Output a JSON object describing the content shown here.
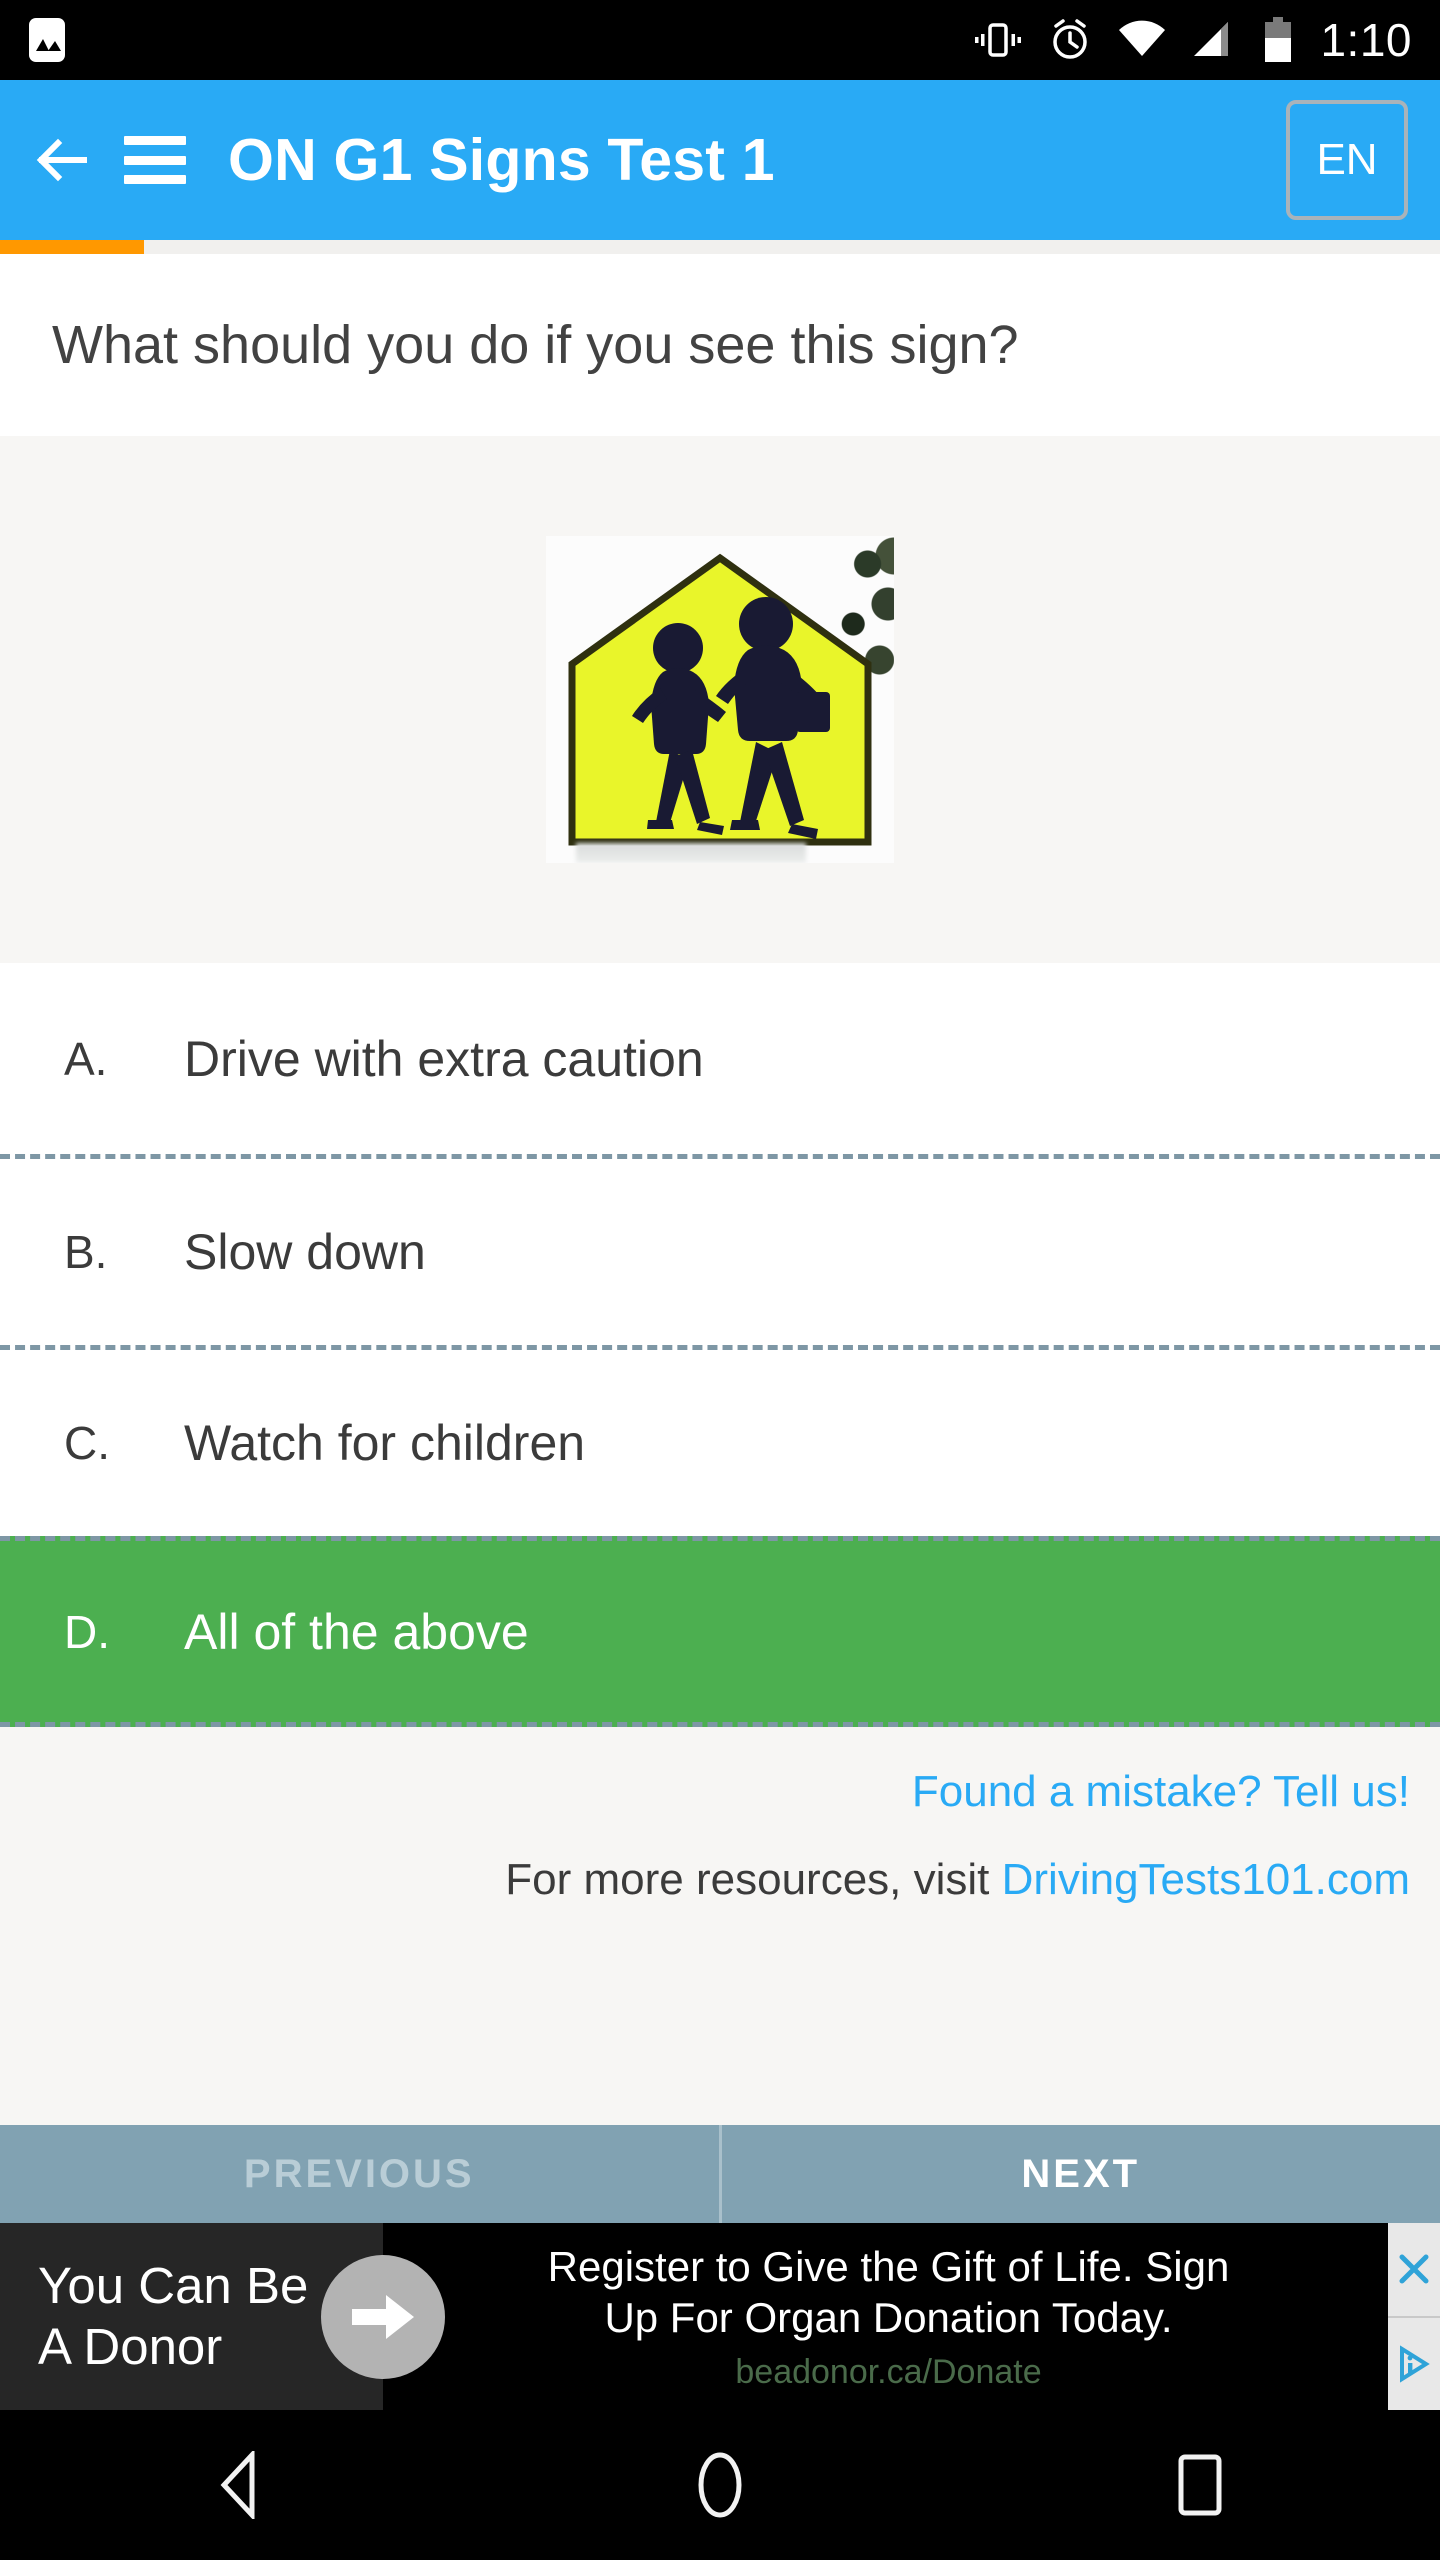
{
  "status_bar": {
    "time": "1:10",
    "icons": [
      "photo-icon",
      "vibrate-icon",
      "alarm-icon",
      "wifi-icon",
      "signal-icon",
      "battery-icon"
    ]
  },
  "app_bar": {
    "title": "ON G1 Signs Test 1",
    "back_icon": "back-arrow-icon",
    "menu_icon": "hamburger-menu-icon",
    "language_label": "EN"
  },
  "progress": {
    "percent": 10,
    "color": "#ff9800"
  },
  "question": {
    "text": "What should you do if you see this sign?",
    "image_alt": "school-crossing-sign"
  },
  "answers": [
    {
      "letter": "A.",
      "text": "Drive with extra caution",
      "correct": false
    },
    {
      "letter": "B.",
      "text": "Slow down",
      "correct": false
    },
    {
      "letter": "C.",
      "text": "Watch for children",
      "correct": false
    },
    {
      "letter": "D.",
      "text": "All of the above",
      "correct": true
    }
  ],
  "footer": {
    "mistake_link": "Found a mistake? Tell us!",
    "resources_prefix": "For more resources, visit ",
    "resources_link": "DrivingTests101.com"
  },
  "navigation": {
    "previous_label": "PREVIOUS",
    "next_label": "NEXT"
  },
  "advertisement": {
    "headline": "You Can Be\nA Donor",
    "headline_line1": "You Can Be",
    "headline_line2": "A Donor",
    "body_line1": "Register to Give the Gift of Life. Sign",
    "body_line2": "Up For Organ Donation Today.",
    "url": "beadonor.ca/Donate",
    "close_icon": "close-icon",
    "adchoices_icon": "adchoices-icon",
    "arrow_icon": "arrow-right-icon"
  },
  "system_nav": {
    "back_icon": "system-back-icon",
    "home_icon": "system-home-icon",
    "recents_icon": "system-recents-icon"
  },
  "colors": {
    "accent_blue": "#29aaf5",
    "correct_green": "#4caf50",
    "progress_orange": "#ff9800",
    "nav_slate": "#81a2b2",
    "separator": "#7e97a5"
  }
}
